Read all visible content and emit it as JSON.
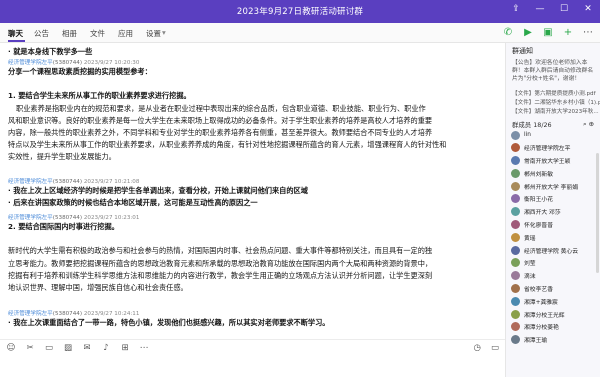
{
  "window": {
    "title": "2023年9月27日教研活动研讨群",
    "controls": [
      "share-icon",
      "minimize-icon",
      "maximize-icon",
      "close-icon"
    ]
  },
  "tabs": {
    "items": [
      "聊天",
      "公告",
      "相册",
      "文件",
      "应用",
      "设置"
    ],
    "active": "聊天",
    "settings_arrow": "▾",
    "right_icons": [
      "phone-icon",
      "video-icon",
      "screen-share-icon",
      "add-member-icon",
      "more-icon"
    ]
  },
  "messages": [
    {
      "lines": [
        {
          "text": "· 就是本身线下教学多一些",
          "style": "bold"
        }
      ]
    },
    {
      "sender": "经济管理学院左平",
      "uid": "(5380744)",
      "time": "2023/9/27 10:20:30",
      "lines": [
        {
          "text": "分享一个课程思政素质挖掘的实用模型参考：",
          "style": "bold"
        },
        {
          "text": "",
          "style": ""
        },
        {
          "text": "  1. 要结合学生未来所从事工作的职业素养要求进行挖掘。",
          "style": "bold"
        },
        {
          "text": "职业素养是指职业内在的规范和要求，是从业者在职业过程中表现出来的综合品质，包含职业道德、职业技能、职业行为、职业作",
          "style": "indent"
        },
        {
          "text": "风和职业意识等。良好的职业素养是每一位大学生在未来职场上取得成功的必备条件。对于学生职业素养的培养是高校人才培养的重要",
          "style": ""
        },
        {
          "text": "内容，除一般共性的职业素养之外，不同学科和专业对学生的职业素养培养各有侧重，甚至差异很大。教师要结合不同专业的人才培养",
          "style": ""
        },
        {
          "text": "特点以及学生未来所从事工作的职业素养要求，从职业素养养成的角度，有针对性地挖掘课程所蕴含的育人元素，增强课程育人的针对性和",
          "style": ""
        },
        {
          "text": "实效性，提升学生职业发展能力。",
          "style": ""
        }
      ]
    },
    {
      "sender": "经济管理学院左平",
      "uid": "(5380744)",
      "time": "2023/9/27 10:21:08",
      "lines": [
        {
          "text": "· 我在上次上区域经济学的时候是把学生各单调出来，查看分校，开始上课就问他们来自的区域",
          "style": "bold"
        },
        {
          "text": "· 后来在讲国家政策的时候也结合本地区域开展，这可能是互动性高的原因之一",
          "style": "bold"
        }
      ]
    },
    {
      "sender": "经济管理学院左平",
      "uid": "(5380744)",
      "time": "2023/9/27 10:23:01",
      "lines": [
        {
          "text": "  2. 要结合国际国内时事进行挖掘。",
          "style": "bold"
        },
        {
          "text": "",
          "style": ""
        },
        {
          "text": "新时代的大学生需有积极的政治参与和社会参与的热情，对国际国内时事、社会热点问题、重大事件等都特别关注，而且具有一定的独",
          "style": ""
        },
        {
          "text": "立思考能力。教师要把挖掘课程所蕴含的思想政治教育元素和所承载的思想政治教育功能放在国际国内两个大局和两种资源的背景中，",
          "style": ""
        },
        {
          "text": "挖掘有利于培养和训练学生科学思维方法和思维能力的内容进行教学，教会学生用正确的立场观点方法认识并分析问题，让学生更深刻",
          "style": ""
        },
        {
          "text": "地认识世界、理解中国，增强民族自信心和社会责任感。",
          "style": ""
        }
      ]
    },
    {
      "sender": "经济管理学院左平",
      "uid": "(5380744)",
      "time": "2023/9/27 10:24:11",
      "lines": [
        {
          "text": "· 我在上次课重面结合了一带一路，特色小镇，发现他们也挺感兴趣，所以其实对老师要求不断学习。",
          "style": "bold"
        }
      ]
    }
  ],
  "input": {
    "left_icons": [
      "emoji-icon",
      "scissors-icon",
      "folder-icon",
      "image-icon",
      "gift-icon",
      "mic-icon",
      "apps-icon",
      "more-icon"
    ],
    "right_icons": [
      "history-icon",
      "chat-icon"
    ]
  },
  "sidebar": {
    "notice_title": "群通知",
    "notice_text": "【公告】欢迎各位老师加入本群！本群入群后请自动修改群名片为\"分校+姓名\"，谢谢！",
    "files": [
      "【文件】第六期提质提质小测.pdf",
      "【文件】二湘铭华东乡村小镇（1).pdf",
      "【文件】湖南开放大学2023年秋..."
    ],
    "members_label": "群成员 18/26",
    "members_icons": "⌕ ⊕",
    "members": [
      {
        "name": "lin",
        "color": "#7b8fa8"
      },
      {
        "name": "经济管理学院左平",
        "color": "#b05a3a"
      },
      {
        "name": "常南开放大学王颖",
        "color": "#5a7ab0"
      },
      {
        "name": "郴州刘新敏",
        "color": "#6a9a6a"
      },
      {
        "name": "郴州开放大学 李丽娟",
        "color": "#a88a5a"
      },
      {
        "name": "衡阳王小花",
        "color": "#8a6aa8"
      },
      {
        "name": "湘西开大 邓莎",
        "color": "#5aa0a0"
      },
      {
        "name": "怀化廖晋普",
        "color": "#a05a7a"
      },
      {
        "name": "黄瑶",
        "color": "#c09040"
      },
      {
        "name": "经济管理学院 黄心云",
        "color": "#5a6aa0"
      },
      {
        "name": "刘莹",
        "color": "#7aa05a"
      },
      {
        "name": "滴沫",
        "color": "#9a7a9a"
      },
      {
        "name": "省校李艺香",
        "color": "#a0704a"
      },
      {
        "name": "湘潭+龚雅宸",
        "color": "#4a8ab0"
      },
      {
        "name": "湘潭分校王光辉",
        "color": "#8aa04a"
      },
      {
        "name": "湘潭分校姜艳",
        "color": "#b06a5a"
      },
      {
        "name": "湘潭王瑜",
        "color": "#6a7a8a"
      }
    ]
  }
}
